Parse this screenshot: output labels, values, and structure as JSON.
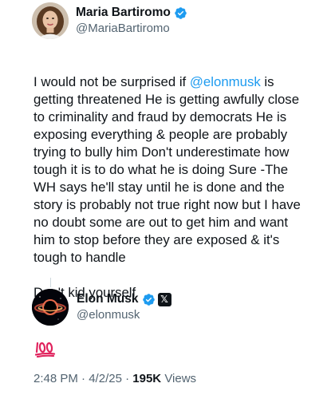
{
  "author": {
    "display_name": "Maria Bartiromo",
    "handle": "@MariaBartiromo",
    "verified_color": "#1d9bf0"
  },
  "tweet": {
    "text_before_mention": "I would not be surprised if ",
    "mention": "@elonmusk",
    "text_after_mention": " is getting threatened   He is getting awfully close to criminality and fraud by democrats He is exposing everything & people are probably trying to bully him  Don't underestimate how tough it is to do what he is doing   Sure -The WH says he'll stay until he is done and the story is probably not true right now but I have no doubt some are out to get him and want him to stop before they are exposed & it's tough to handle",
    "closing_line": "Don't kid yourself"
  },
  "quoted": {
    "display_name": "Elon Musk",
    "handle": "@elonmusk",
    "affiliation_badge": "𝕏",
    "emoji": "100"
  },
  "meta": {
    "time": "2:48 PM",
    "separator": "·",
    "date": "4/2/25",
    "views_count": "195K",
    "views_label": "Views"
  },
  "colors": {
    "text": "#0f1419",
    "secondary": "#536471",
    "link": "#1d9bf0",
    "emoji_red": "#e0245e"
  },
  "icons": {
    "verified": "verified-badge-icon",
    "affiliation": "x-logo-icon",
    "emoji": "hundred-points-emoji"
  }
}
